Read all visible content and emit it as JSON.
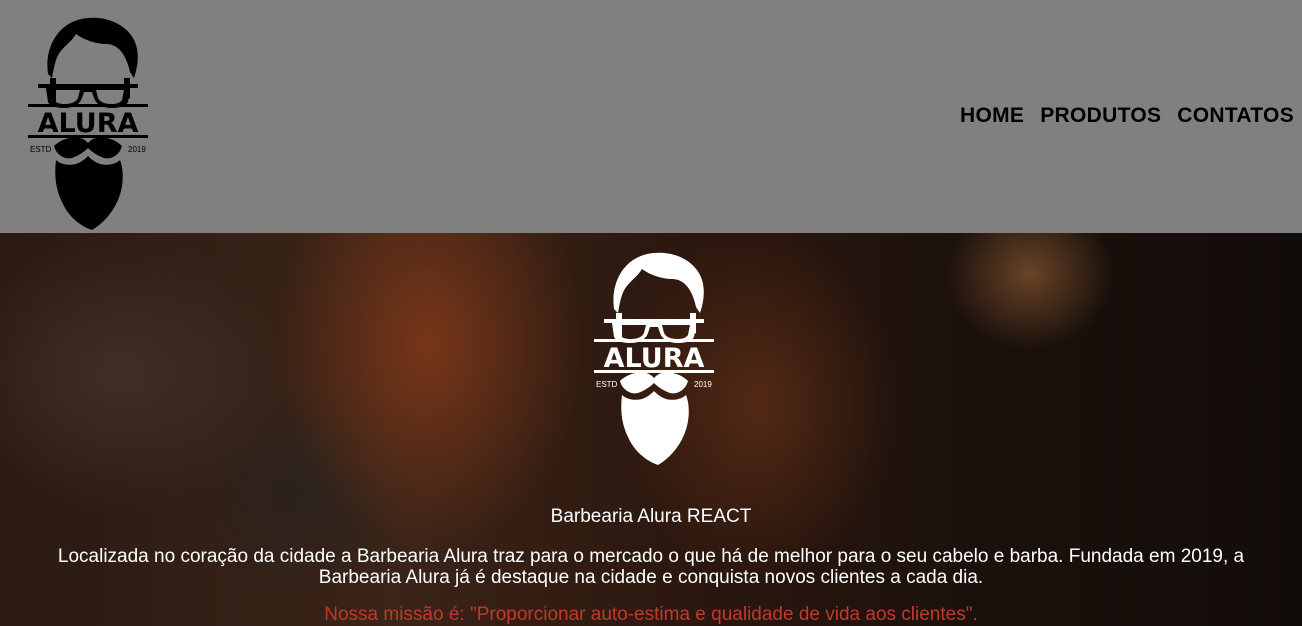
{
  "header": {
    "logo": {
      "brand": "ALURA",
      "estd_label": "ESTD",
      "year": "2019",
      "icon": "bearded-man-logo-icon"
    },
    "nav": [
      {
        "label": "HOME"
      },
      {
        "label": "PRODUTOS"
      },
      {
        "label": "CONTATOS"
      }
    ]
  },
  "hero": {
    "logo": {
      "brand": "ALURA",
      "estd_label": "ESTD",
      "year": "2019"
    },
    "title": "Barbearia Alura REACT",
    "description": "Localizada no coração da cidade a Barbearia Alura traz para o mercado o que há de melhor para o seu cabelo e barba. Fundada em 2019, a Barbearia Alura já é destaque na cidade e conquista novos clientes a cada dia.",
    "mission": "Nossa missão é: \"Proporcionar auto-estima e qualidade de vida aos clientes\"."
  },
  "colors": {
    "header_bg": "#808080",
    "nav_text": "#000000",
    "hero_text": "#ffffff",
    "mission_text": "#c0392b"
  }
}
